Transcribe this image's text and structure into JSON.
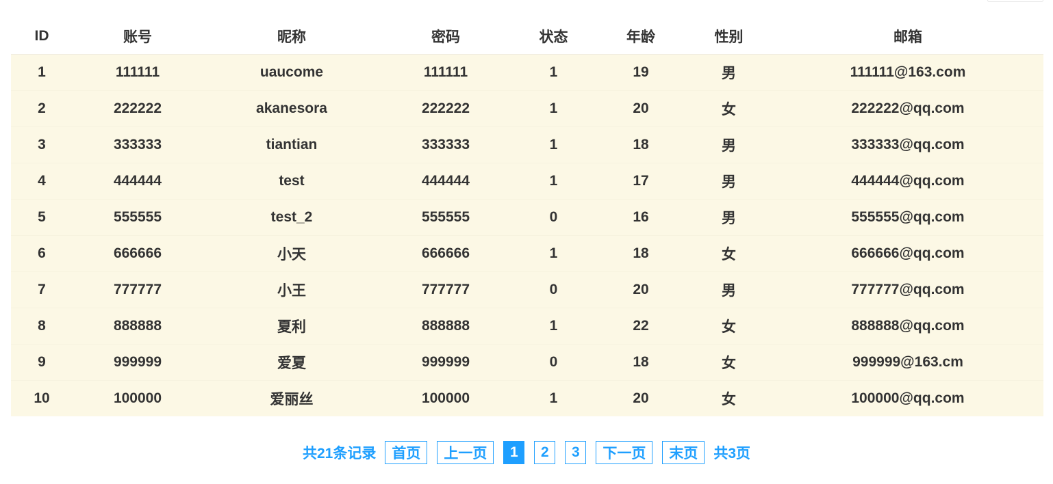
{
  "table": {
    "headers": [
      "ID",
      "账号",
      "昵称",
      "密码",
      "状态",
      "年龄",
      "性别",
      "邮箱"
    ],
    "rows": [
      [
        "1",
        "111111",
        "uaucome",
        "111111",
        "1",
        "19",
        "男",
        "111111@163.com"
      ],
      [
        "2",
        "222222",
        "akanesora",
        "222222",
        "1",
        "20",
        "女",
        "222222@qq.com"
      ],
      [
        "3",
        "333333",
        "tiantian",
        "333333",
        "1",
        "18",
        "男",
        "333333@qq.com"
      ],
      [
        "4",
        "444444",
        "test",
        "444444",
        "1",
        "17",
        "男",
        "444444@qq.com"
      ],
      [
        "5",
        "555555",
        "test_2",
        "555555",
        "0",
        "16",
        "男",
        "555555@qq.com"
      ],
      [
        "6",
        "666666",
        "小天",
        "666666",
        "1",
        "18",
        "女",
        "666666@qq.com"
      ],
      [
        "7",
        "777777",
        "小王",
        "777777",
        "0",
        "20",
        "男",
        "777777@qq.com"
      ],
      [
        "8",
        "888888",
        "夏利",
        "888888",
        "1",
        "22",
        "女",
        "888888@qq.com"
      ],
      [
        "9",
        "999999",
        "爱夏",
        "999999",
        "0",
        "18",
        "女",
        "999999@163.cm"
      ],
      [
        "10",
        "100000",
        "爱丽丝",
        "100000",
        "1",
        "20",
        "女",
        "100000@qq.com"
      ]
    ]
  },
  "pagination": {
    "total_records": "共21条记录",
    "first": "首页",
    "prev": "上一页",
    "pages": [
      "1",
      "2",
      "3"
    ],
    "current_page": "1",
    "next": "下一页",
    "last": "末页",
    "total_pages": "共3页"
  },
  "colors": {
    "row_background": "#fcf8e5",
    "accent": "#1e9fff",
    "text": "#333333"
  }
}
